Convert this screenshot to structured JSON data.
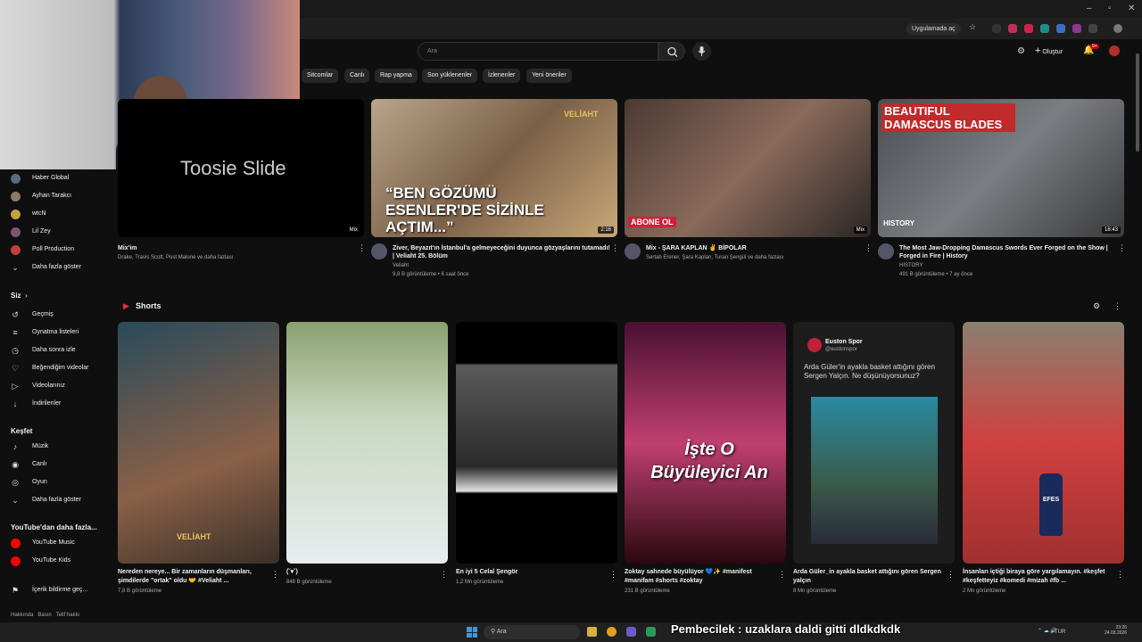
{
  "browser": {
    "app_open_label": "Uygulamada aç"
  },
  "masthead": {
    "search_placeholder": "Ara",
    "create_label": "Oluştur",
    "notif_count": "9+"
  },
  "chips": [
    "Sitcomlar",
    "Canlı",
    "Rap yapma",
    "Son yüklenenler",
    "İzlenenler",
    "Yeni öneriler"
  ],
  "sidebar": {
    "subscriptions": [
      {
        "label": "Haber Global",
        "color": "#5a6b7a"
      },
      {
        "label": "Ayhan Tarakcı",
        "color": "#8a7a6a"
      },
      {
        "label": "wtcN",
        "color": "#c8a040"
      },
      {
        "label": "Lil Zey",
        "color": "#7a5a6a"
      },
      {
        "label": "Poll Production",
        "color": "#c04040"
      }
    ],
    "show_more_1": "Daha fazla göster",
    "you_header": "Siz",
    "you_items": [
      {
        "icon": "history-icon",
        "glyph": "↺",
        "label": "Geçmiş"
      },
      {
        "icon": "playlists-icon",
        "glyph": "≡",
        "label": "Oynatma listeleri"
      },
      {
        "icon": "watch-later-icon",
        "glyph": "◷",
        "label": "Daha sonra izle"
      },
      {
        "icon": "liked-icon",
        "glyph": "♡",
        "label": "Beğendiğim videolar"
      },
      {
        "icon": "your-videos-icon",
        "glyph": "▷",
        "label": "Videolarınız"
      },
      {
        "icon": "downloads-icon",
        "glyph": "↓",
        "label": "İndirilenler"
      }
    ],
    "explore_header": "Keşfet",
    "explore_items": [
      {
        "icon": "music-icon",
        "glyph": "♪",
        "label": "Müzik"
      },
      {
        "icon": "live-icon",
        "glyph": "◉",
        "label": "Canlı"
      },
      {
        "icon": "gaming-icon",
        "glyph": "◎",
        "label": "Oyun"
      }
    ],
    "show_more_2": "Daha fazla göster",
    "more_header": "YouTube'dan daha fazla...",
    "more_items": [
      "YouTube Music",
      "YouTube Kids"
    ],
    "report": "İçerik bildirme geç...",
    "footer": "Hakkında   Basın   Telif hakkı"
  },
  "videos": [
    {
      "title": "Mix'im",
      "meta1": "Drake, Travis Scott, Post Malone ve daha fazlası",
      "meta2": "",
      "badge": "Mix",
      "thumb_text": "Toosie Slide"
    },
    {
      "title": "Ziver, Beyazıt'ın İstanbul'a gelmeyeceğini duyunca gözyaşlarını tutamadı! | Veliaht 25. Bölüm",
      "meta1": "Veliaht",
      "meta2": "9,8 B görüntüleme • 6 saat önce",
      "badge": "2:16",
      "thumb_text": "“BEN GÖZÜMÜ ESENLER'DE SİZİNLE AÇTIM...”",
      "brand": "VELİAHT"
    },
    {
      "title": "Mix - ŞARA KAPLAN ✌️ BİPOLAR",
      "meta1": "Sertab Erener, Şara Kaplan, Turan Şengül ve daha fazlası",
      "meta2": "",
      "badge": "Mix",
      "thumb_text": "ABONE OL"
    },
    {
      "title": "The Most Jaw-Dropping Damascus Swords Ever Forged on the Show | Forged in Fire | History",
      "meta1": "HISTORY",
      "meta2": "491 B görüntüleme • 7 ay önce",
      "badge": "18:43",
      "thumb_text": "BEAUTIFUL DAMASCUS BLADES",
      "brand": "HISTORY"
    }
  ],
  "shorts": {
    "header": "Shorts",
    "items": [
      {
        "title": "Nereden nereye... Bir zamanların düşmanları, şimdilerde \"ortak\" oldu 🤝 #Veliaht ...",
        "views": "7,8 B görüntüleme",
        "brand": "VELİAHT"
      },
      {
        "title": "(˘▾˘)",
        "views": "848 B görüntüleme"
      },
      {
        "title": "En iyi 5 Celal Şengör",
        "views": "1,2 Mn görüntüleme"
      },
      {
        "title": "Zoktay sahnede büyülüyor 💙✨ #manifest #manifam #shorts #zoktay",
        "views": "231 B görüntüleme",
        "overlay": "İşte O Büyüleyici An"
      },
      {
        "title": "Arda Güler_in ayakla basket attığını gören Sergen yalçın",
        "views": "8 Mn görüntüleme",
        "tweet_user": "Euston Spor",
        "tweet_handle": "@eustonspor",
        "tweet_text": "Arda Güler'in ayakla basket attığını gören Sergen Yalçın. Ne düşünüyorsunuz?"
      },
      {
        "title": "İnsanları içtiği biraya göre yargılamayın. #keşfet #keşfetteyiz #komedi #mizah #fb ...",
        "views": "2 Mn görüntüleme",
        "bottle": "EFES"
      }
    ]
  },
  "taskbar": {
    "search": "Ara",
    "lang": "TUR",
    "time": "23:26",
    "date": "24.03.2026"
  },
  "overlay_chat": "Pembecilek : uzaklara daldi gitti dldkdkdk"
}
